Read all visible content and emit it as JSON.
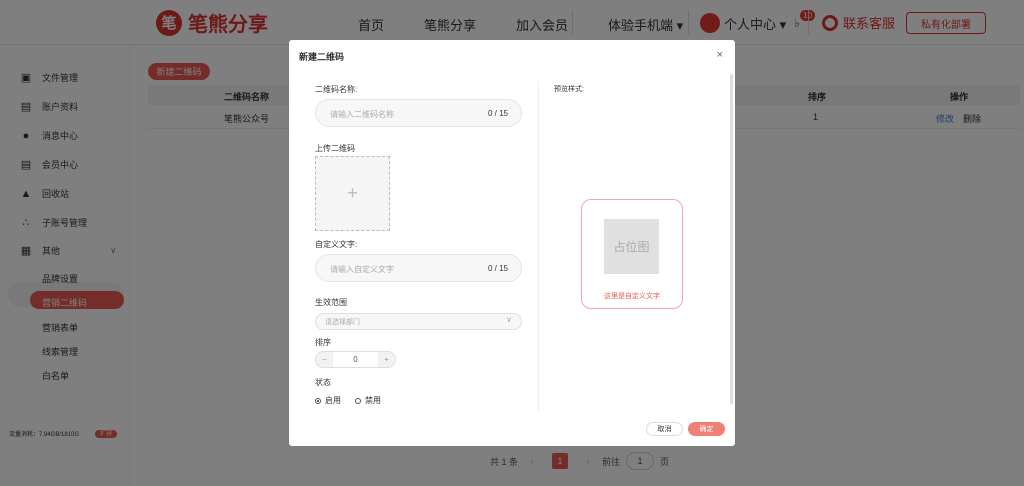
{
  "header": {
    "logo_mark": "笔",
    "logo_text": "笔熊分享",
    "nav": [
      "首页",
      "笔熊分享",
      "加入会员",
      "体验手机端 ▾"
    ],
    "user_label": "个人中心 ▾",
    "bell_badge": "10",
    "service_label": "联系客服",
    "private_label": "私有化部署"
  },
  "sidebar": {
    "items": [
      {
        "label": "文件管理",
        "icon": "folder-icon"
      },
      {
        "label": "账户资料",
        "icon": "id-card-icon"
      },
      {
        "label": "消息中心",
        "icon": "message-icon"
      },
      {
        "label": "会员中心",
        "icon": "card-icon"
      },
      {
        "label": "回收站",
        "icon": "trash-icon"
      },
      {
        "label": "子账号管理",
        "icon": "org-icon"
      }
    ],
    "group_label": "其他",
    "sub_items": [
      "品牌设置",
      "营销二维码",
      "营销表单",
      "线索管理",
      "白名单"
    ],
    "storage_text": "流量消耗：7.94GB/1810G",
    "storage_btn": "扩容"
  },
  "main": {
    "new_button": "新建二维码",
    "table_headers": [
      "二维码名称",
      "排序",
      "操作"
    ],
    "row": {
      "name": "笔熊公众号",
      "sort": "1",
      "edit": "修改",
      "delete": "删除"
    },
    "pager": {
      "total": "共 1 条",
      "page": "1",
      "goto": "前往",
      "goto_value": "1",
      "unit": "页",
      "prev": "‹",
      "next": "›"
    }
  },
  "modal": {
    "title": "新建二维码",
    "close": "×",
    "name_label": "二维码名称:",
    "name_placeholder": "请输入二维码名称",
    "name_count": "0 / 15",
    "upload_label": "上传二维码",
    "upload_plus": "+",
    "custom_label": "自定义文字:",
    "custom_placeholder": "请输入自定义文字",
    "custom_count": "0 / 15",
    "scope_label": "生效范围",
    "scope_placeholder": "请选择部门",
    "sort_label": "排序",
    "sort_value": "0",
    "status_label": "状态",
    "status_on": "启用",
    "status_off": "禁用",
    "preview_label": "预览样式:",
    "preview_placeholder": "占位图",
    "preview_text": "这里是自定义文字",
    "cancel": "取消",
    "confirm": "确定"
  }
}
